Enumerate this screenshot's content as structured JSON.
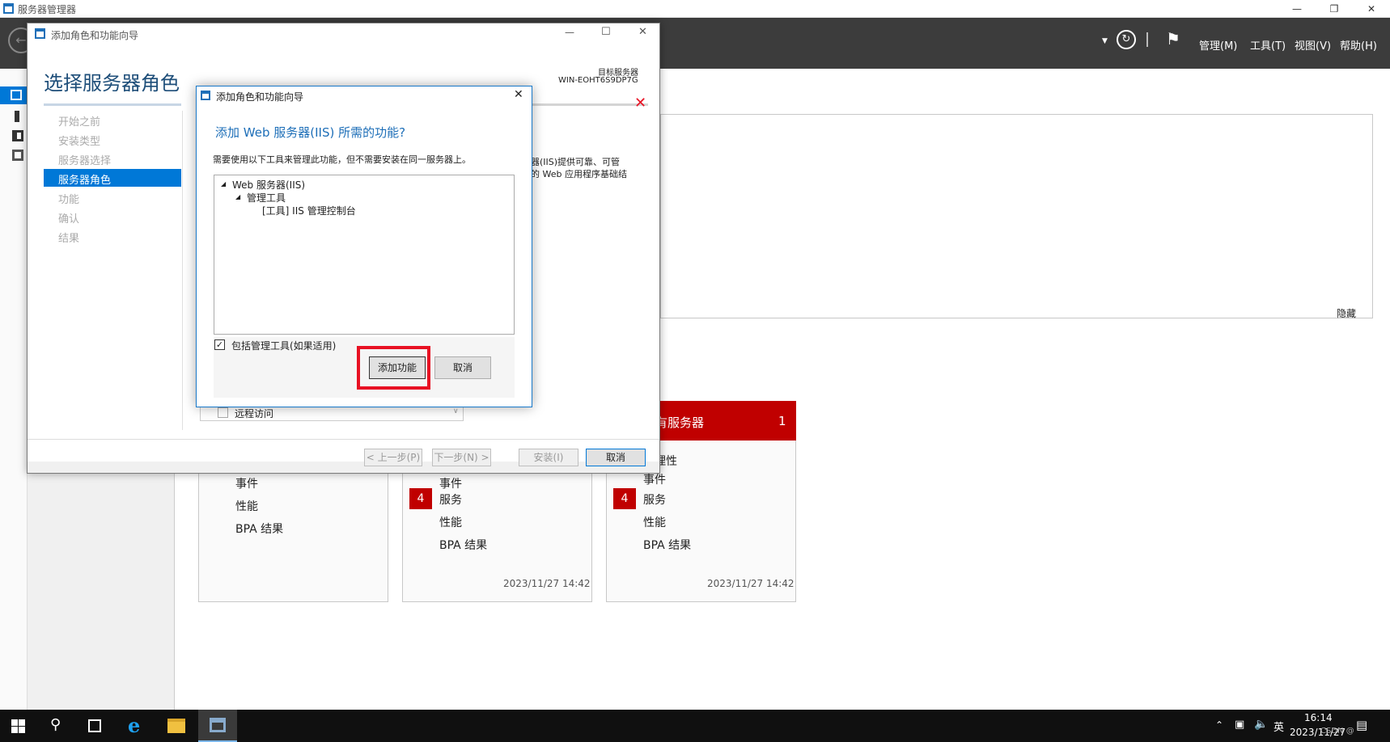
{
  "main_window": {
    "title": "服务器管理器",
    "menus": [
      "管理(M)",
      "工具(T)",
      "视图(V)",
      "帮助(H)"
    ]
  },
  "dashboard": {
    "hide_label": "隐藏",
    "tiles": [
      {
        "rows": [
          "事件",
          "性能",
          "BPA 结果"
        ],
        "badge": null,
        "date": ""
      },
      {
        "rows": [
          "事件",
          "服务",
          "性能",
          "BPA 结果"
        ],
        "badge": "4",
        "date": "2023/11/27 14:42"
      },
      {
        "header_title": "有服务器",
        "header_count": "1",
        "rows": [
          "管理性",
          "事件",
          "服务",
          "性能",
          "BPA 结果"
        ],
        "badge": "4",
        "date": "2023/11/27 14:42"
      }
    ],
    "remote_access_label": "远程访问"
  },
  "wizard": {
    "title": "添加角色和功能向导",
    "heading": "选择服务器角色",
    "target_label": "目标服务器",
    "target_value": "WIN-EOHT6S9DP7G",
    "nav": [
      "开始之前",
      "安装类型",
      "服务器选择",
      "服务器角色",
      "功能",
      "确认",
      "结果"
    ],
    "active_nav": "服务器角色",
    "desc_line1": "器(IIS)提供可靠、可管",
    "desc_line2": "的 Web 应用程序基础结",
    "buttons": {
      "prev": "< 上一步(P)",
      "next": "下一步(N) >",
      "install": "安装(I)",
      "cancel": "取消"
    }
  },
  "popup": {
    "title": "添加角色和功能向导",
    "heading": "添加 Web 服务器(IIS) 所需的功能?",
    "description": "需要使用以下工具来管理此功能，但不需要安装在同一服务器上。",
    "tree": [
      "Web 服务器(IIS)",
      "管理工具",
      "[工具] IIS 管理控制台"
    ],
    "checkbox_label": "包括管理工具(如果适用)",
    "checkbox_checked": true,
    "add_button": "添加功能",
    "cancel_button": "取消"
  },
  "taskbar": {
    "time": "16:14",
    "date": "2023/11/27",
    "ime": "英",
    "watermark": "CSDN @"
  },
  "colors": {
    "accent": "#0078d7",
    "badge_red": "#c00000",
    "highlight_box": "#e81123"
  }
}
